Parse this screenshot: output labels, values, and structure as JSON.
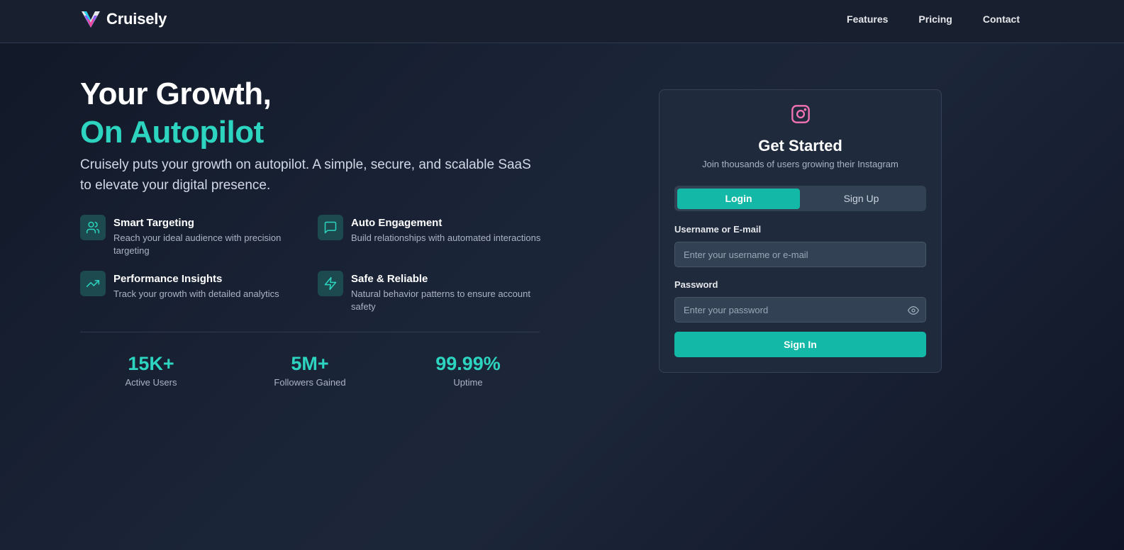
{
  "brand": {
    "name": "Cruisely",
    "logo_icon": "chevron-v-logo",
    "accent": "#2dd4bf"
  },
  "nav": {
    "items": [
      "Features",
      "Pricing",
      "Contact"
    ]
  },
  "hero": {
    "title_line1": "Your Growth,",
    "title_line2": "On Autopilot",
    "description": "Cruisely puts your growth on autopilot. A simple, secure, and scalable SaaS to elevate your digital presence."
  },
  "features": [
    {
      "icon": "users-icon",
      "title": "Smart Targeting",
      "desc": "Reach your ideal audience with precision targeting"
    },
    {
      "icon": "message-icon",
      "title": "Auto Engagement",
      "desc": "Build relationships with automated interactions"
    },
    {
      "icon": "trending-up-icon",
      "title": "Performance Insights",
      "desc": "Track your growth with detailed analytics"
    },
    {
      "icon": "lightning-icon",
      "title": "Safe & Reliable",
      "desc": "Natural behavior patterns to ensure account safety"
    }
  ],
  "stats": [
    {
      "value": "15K+",
      "label": "Active Users"
    },
    {
      "value": "5M+",
      "label": "Followers Gained"
    },
    {
      "value": "99.99%",
      "label": "Uptime"
    }
  ],
  "card": {
    "icon": "instagram-icon",
    "title": "Get Started",
    "subtitle": "Join thousands of users growing their Instagram",
    "tabs": [
      "Login",
      "Sign Up"
    ],
    "active_tab": "Login",
    "username_label": "Username or E-mail",
    "username_placeholder": "Enter your username or e-mail",
    "password_label": "Password",
    "password_placeholder": "Enter your password",
    "submit_label": "Sign In"
  }
}
